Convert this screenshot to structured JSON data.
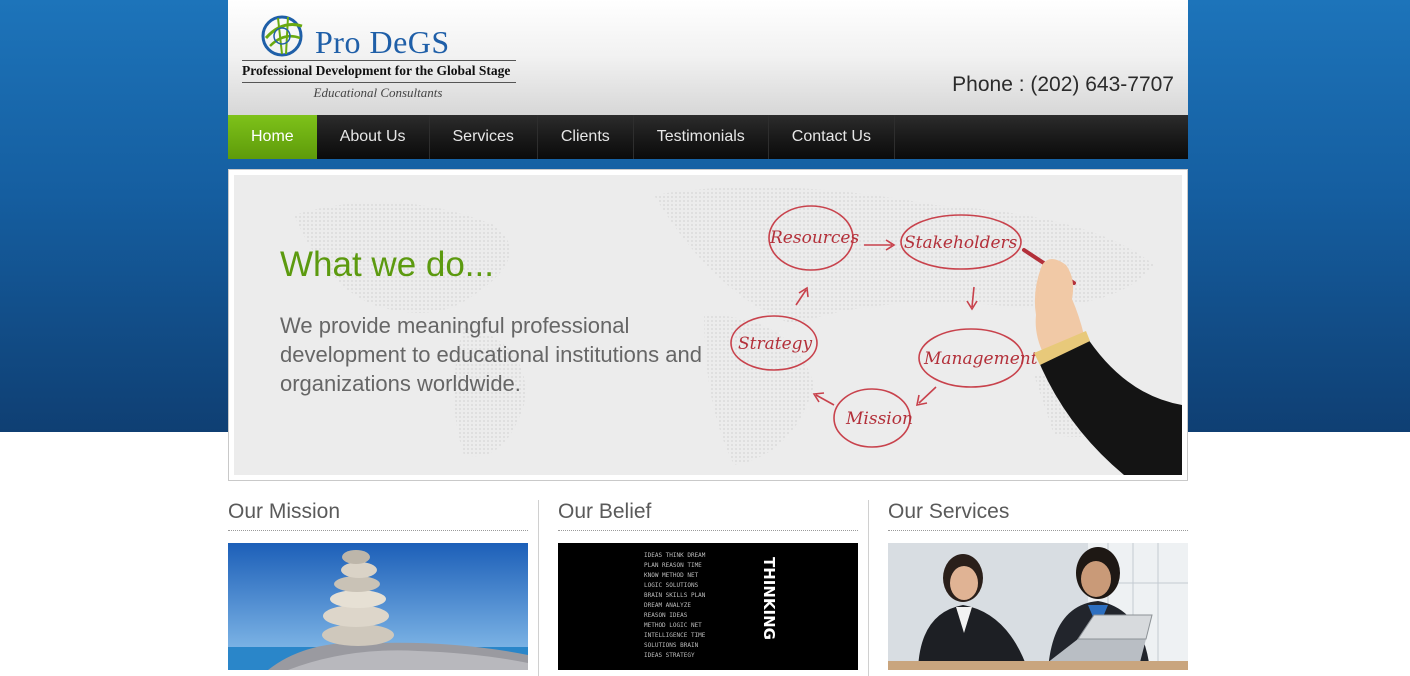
{
  "brand": {
    "name_part1": "Pro",
    "name_part2": "DeGS",
    "tagline": "Professional Development for the Global Stage",
    "subtitle": "Educational Consultants"
  },
  "header": {
    "phone": "Phone : (202) 643-7707"
  },
  "nav": {
    "items": [
      {
        "label": "Home",
        "active": true
      },
      {
        "label": "About Us"
      },
      {
        "label": "Services"
      },
      {
        "label": "Clients"
      },
      {
        "label": "Testimonials"
      },
      {
        "label": "Contact Us"
      }
    ]
  },
  "hero": {
    "heading": "What we do...",
    "text": "We provide meaningful professional development to educational institutions and organizations worldwide.",
    "diagram": {
      "labels": [
        "Resources",
        "Stakeholders",
        "Management",
        "Mission",
        "Strategy"
      ]
    }
  },
  "sections": [
    {
      "title": "Our Mission",
      "image": "balanced-stones-photo"
    },
    {
      "title": "Our Belief",
      "image": "thinking-word-cloud-photo"
    },
    {
      "title": "Our Services",
      "image": "business-women-laptop-photo"
    }
  ],
  "belief_image_text": "THINKING",
  "colors": {
    "accent_green": "#5c9a0f",
    "nav_active": "#6aaa10",
    "brand_blue": "#1f5fa8",
    "diagram_red": "#b3303a"
  }
}
